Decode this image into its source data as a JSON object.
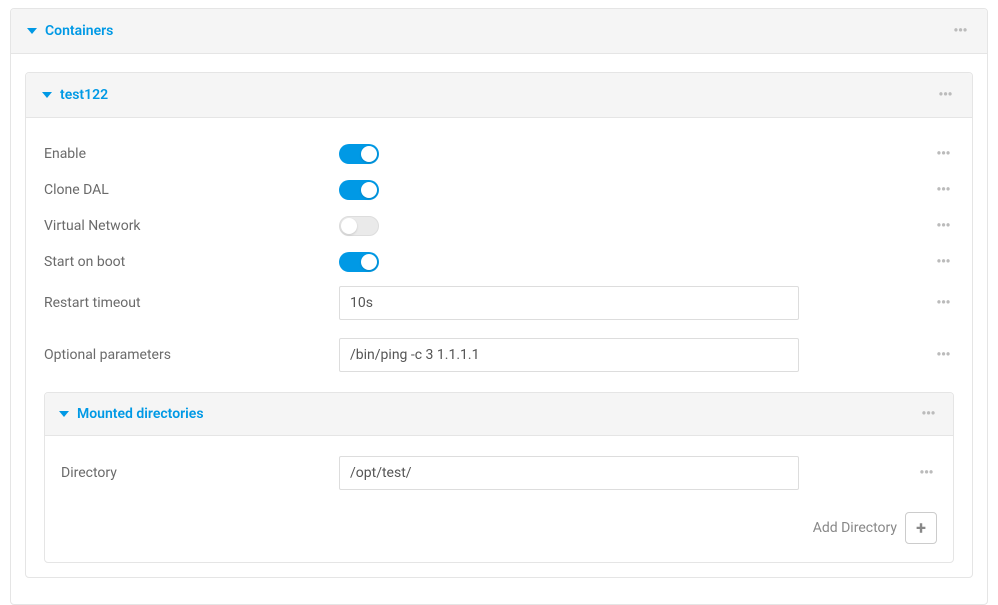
{
  "containers": {
    "title": "Containers",
    "item": {
      "title": "test122",
      "fields": {
        "enable": {
          "label": "Enable",
          "value": true
        },
        "clone_dal": {
          "label": "Clone DAL",
          "value": true
        },
        "virtual_network": {
          "label": "Virtual Network",
          "value": false
        },
        "start_on_boot": {
          "label": "Start on boot",
          "value": true
        },
        "restart_timeout": {
          "label": "Restart timeout",
          "value": "10s"
        },
        "optional_parameters": {
          "label": "Optional parameters",
          "value": "/bin/ping -c 3 1.1.1.1"
        }
      },
      "mounted": {
        "title": "Mounted directories",
        "directory": {
          "label": "Directory",
          "value": "/opt/test/"
        },
        "add_label": "Add Directory"
      }
    }
  }
}
